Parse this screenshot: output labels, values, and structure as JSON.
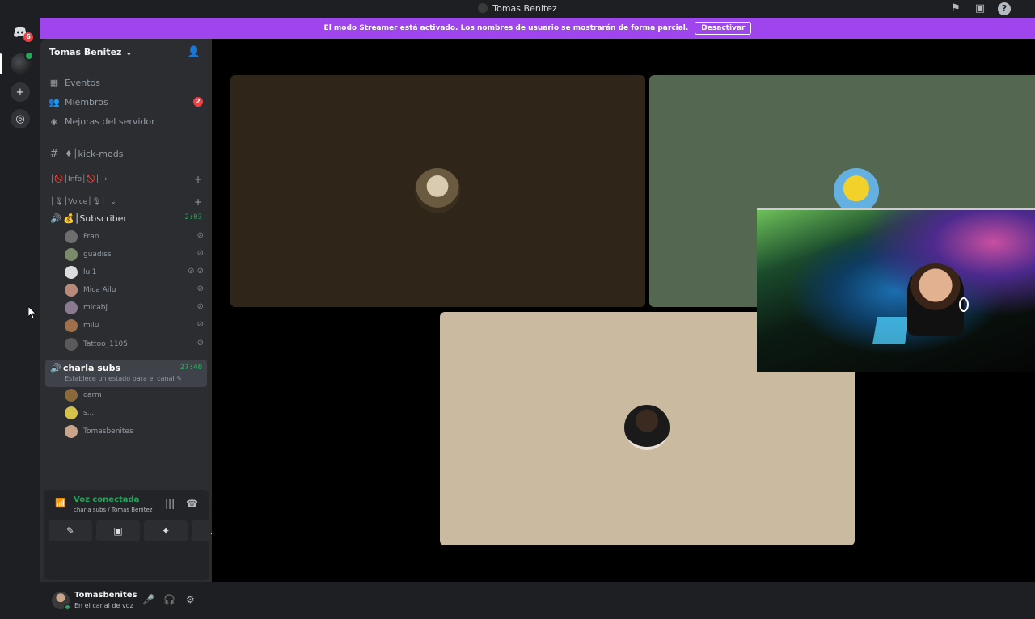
{
  "window": {
    "title": "Tomas Benitez"
  },
  "rail": {
    "discord_badge": "6"
  },
  "streamer_banner": {
    "text": "El modo Streamer está activado. Los nombres de usuario se mostrarán de forma parcial.",
    "button": "Desactivar"
  },
  "server": {
    "name": "Tomas Benitez",
    "nav": [
      {
        "label": "Eventos",
        "icon": "calendar-icon"
      },
      {
        "label": "Miembros",
        "icon": "members-icon",
        "count": "2"
      },
      {
        "label": "Mejoras del servidor",
        "icon": "boost-icon"
      }
    ],
    "text_channel": "♦│kick-mods",
    "categories": [
      {
        "label": "│🚫│Info│🚫│",
        "chevron": "›"
      },
      {
        "label": "│🎙│Voice│🎙│",
        "chevron": "⌄"
      }
    ],
    "voice_channels": [
      {
        "name": "💰│Subscriber",
        "timer": "2:03",
        "users": [
          "Fran",
          "guadiss",
          "lul1",
          "Mica Ailu",
          "micabj",
          "milu",
          "Tattoo_1105"
        ]
      },
      {
        "name": "charla subs",
        "timer": "27:40",
        "status_hint": "Establece un estado para el canal",
        "users": [
          "carm!",
          "s...",
          "Tomasbenites"
        ]
      }
    ]
  },
  "voice_panel": {
    "status": "Voz conectada",
    "location": "charla subs / Tomas Benitez"
  },
  "user": {
    "name": "Tomasbenites",
    "status": "En el canal de voz"
  },
  "colors": {
    "accent": "#9e45ee",
    "green": "#23a55a",
    "red": "#f23f43",
    "tile1": "#2f2619",
    "tile2": "#536751",
    "tile3": "#c9baa0"
  }
}
